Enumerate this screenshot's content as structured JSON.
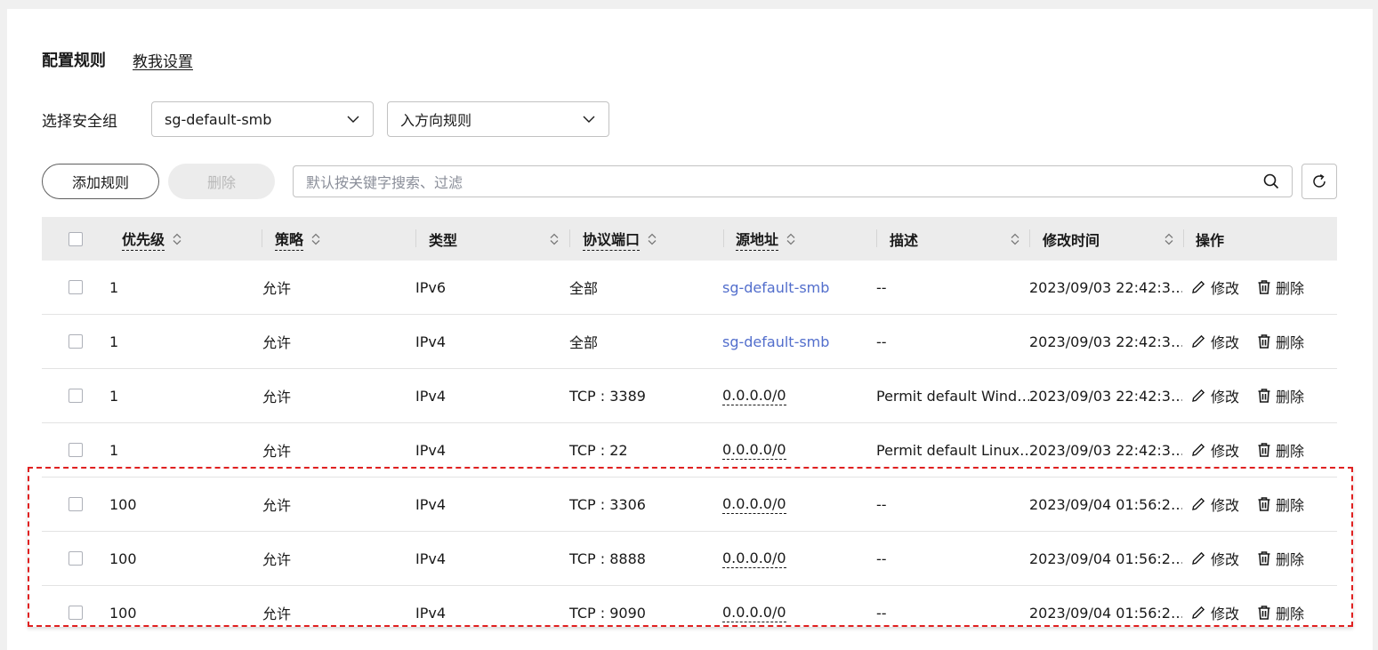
{
  "header": {
    "title": "配置规则",
    "help_link": "教我设置"
  },
  "security_group": {
    "label": "选择安全组",
    "selected_group": "sg-default-smb",
    "selected_direction": "入方向规则"
  },
  "toolbar": {
    "add_label": "添加规则",
    "delete_label": "删除",
    "search_placeholder": "默认按关键字搜索、过滤"
  },
  "table": {
    "columns": {
      "priority": "优先级",
      "policy": "策略",
      "type": "类型",
      "protocol_port": "协议端口",
      "source": "源地址",
      "description": "描述",
      "modified": "修改时间",
      "actions": "操作"
    },
    "action_labels": {
      "edit": "修改",
      "delete": "删除"
    },
    "rows": [
      {
        "priority": "1",
        "policy": "允许",
        "type": "IPv6",
        "protocol_port": "全部",
        "source": "sg-default-smb",
        "source_kind": "link",
        "description": "--",
        "modified": "2023/09/03 22:42:3…"
      },
      {
        "priority": "1",
        "policy": "允许",
        "type": "IPv4",
        "protocol_port": "全部",
        "source": "sg-default-smb",
        "source_kind": "link",
        "description": "--",
        "modified": "2023/09/03 22:42:3…"
      },
      {
        "priority": "1",
        "policy": "允许",
        "type": "IPv4",
        "protocol_port": "TCP : 3389",
        "source": "0.0.0.0/0",
        "source_kind": "dotted",
        "description": "Permit default Wind…",
        "modified": "2023/09/03 22:42:3…"
      },
      {
        "priority": "1",
        "policy": "允许",
        "type": "IPv4",
        "protocol_port": "TCP : 22",
        "source": "0.0.0.0/0",
        "source_kind": "dotted",
        "description": "Permit default Linux…",
        "modified": "2023/09/03 22:42:3…"
      },
      {
        "priority": "100",
        "policy": "允许",
        "type": "IPv4",
        "protocol_port": "TCP : 3306",
        "source": "0.0.0.0/0",
        "source_kind": "dotted",
        "description": "--",
        "modified": "2023/09/04 01:56:2…"
      },
      {
        "priority": "100",
        "policy": "允许",
        "type": "IPv4",
        "protocol_port": "TCP : 8888",
        "source": "0.0.0.0/0",
        "source_kind": "dotted",
        "description": "--",
        "modified": "2023/09/04 01:56:2…"
      },
      {
        "priority": "100",
        "policy": "允许",
        "type": "IPv4",
        "protocol_port": "TCP : 9090",
        "source": "0.0.0.0/0",
        "source_kind": "dotted",
        "description": "--",
        "modified": "2023/09/04 01:56:2…"
      }
    ]
  },
  "colors": {
    "link": "#526ecc",
    "highlight_border": "#e02020",
    "header_bg": "#ececec"
  },
  "icons": {
    "sort": "sort-icon",
    "edit": "pencil-icon",
    "delete": "trash-icon",
    "search": "search-icon",
    "refresh": "refresh-icon",
    "dropdown": "chevron-down-icon"
  }
}
